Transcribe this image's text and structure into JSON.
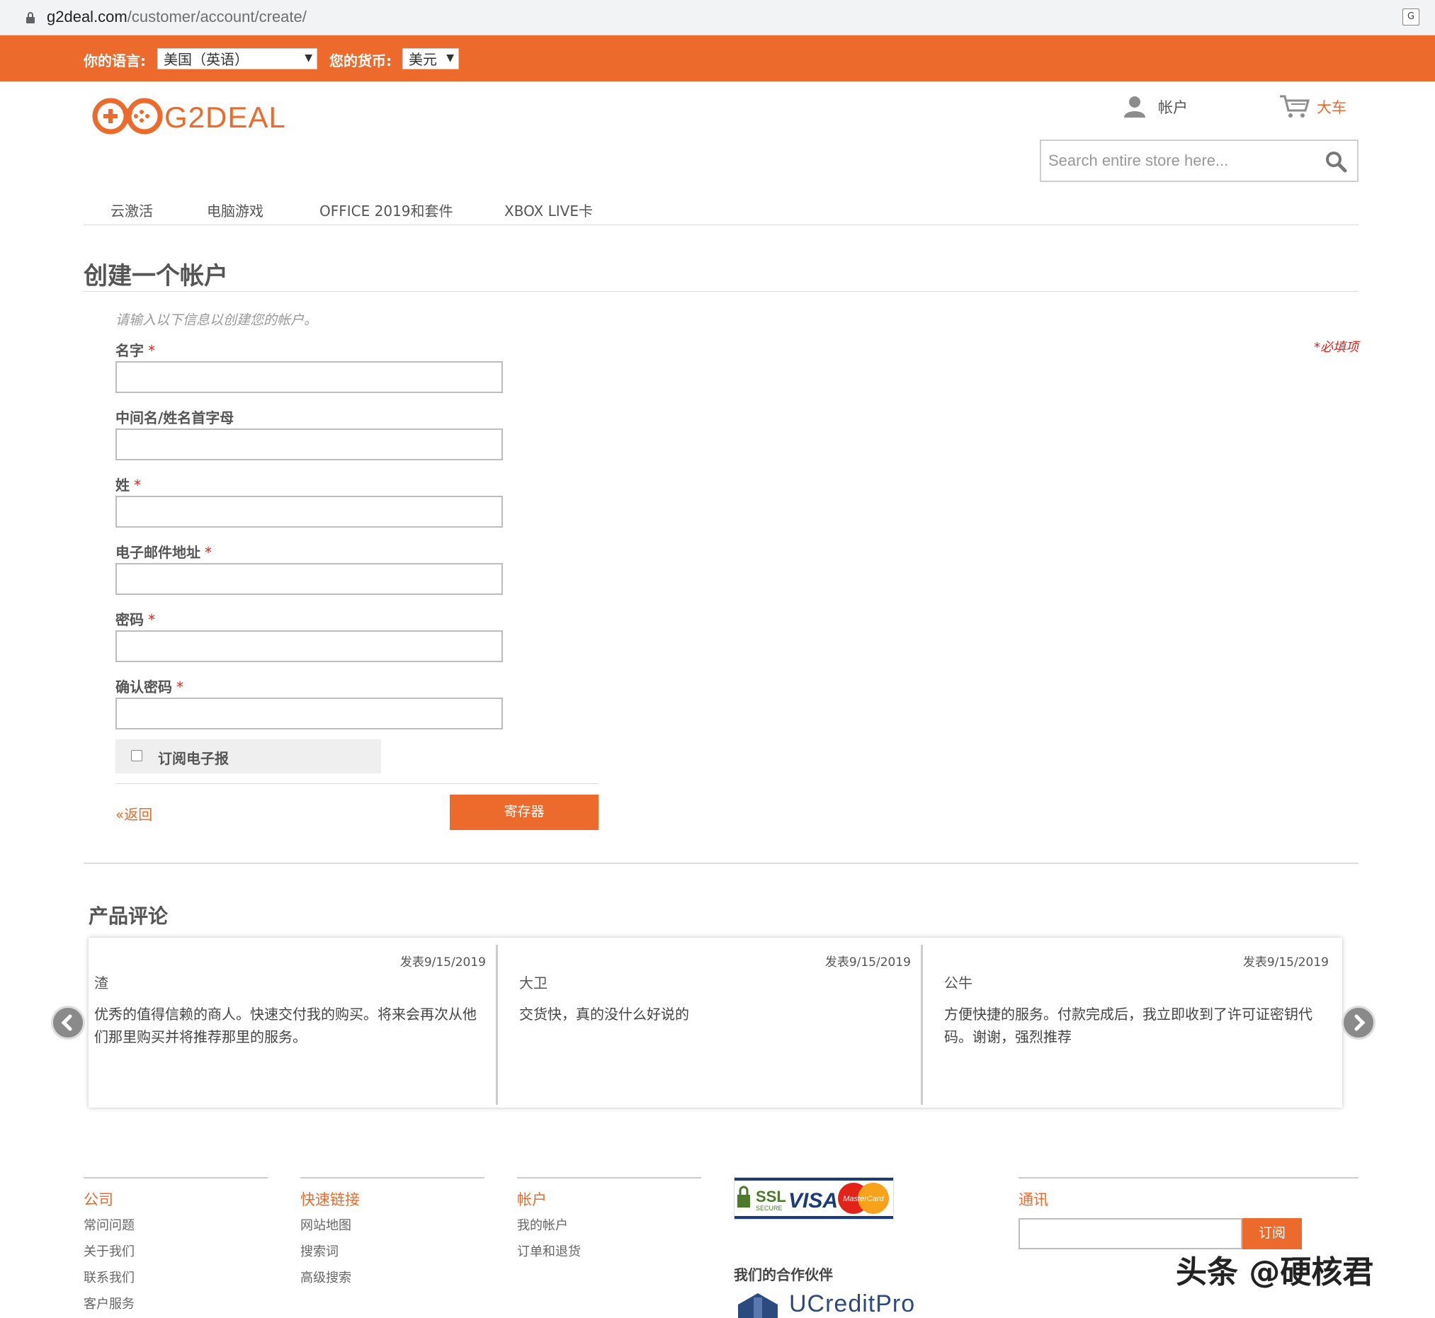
{
  "browser": {
    "url_domain": "g2deal.com",
    "url_path": "/customer/account/create/"
  },
  "topbar": {
    "language_label": "你的语言:",
    "language_value": "美国（英语）",
    "currency_label": "您的货币:",
    "currency_value": "美元"
  },
  "header": {
    "logo_text": "G2DEAL",
    "account_label": "帐户",
    "cart_label": "大车",
    "search_placeholder": "Search entire store here..."
  },
  "nav": {
    "items": [
      "云激活",
      "电脑游戏",
      "OFFICE 2019和套件",
      "XBOX LIVE卡"
    ]
  },
  "form": {
    "title": "创建一个帐户",
    "intro": "请输入以下信息以创建您的帐户。",
    "required_note": "*必填项",
    "required_star": "*",
    "fields": [
      {
        "label": "名字",
        "required": true,
        "value": ""
      },
      {
        "label": "中间名/姓名首字母",
        "required": false,
        "value": ""
      },
      {
        "label": "姓",
        "required": true,
        "value": ""
      },
      {
        "label": "电子邮件地址",
        "required": true,
        "value": ""
      },
      {
        "label": "密码",
        "required": true,
        "value": ""
      },
      {
        "label": "确认密码",
        "required": true,
        "value": ""
      }
    ],
    "newsletter_label": "订阅电子报",
    "newsletter_checked": false,
    "back_label": "«返回",
    "submit_label": "寄存器"
  },
  "reviews": {
    "title": "产品评论",
    "items": [
      {
        "date": "发表9/15/2019",
        "author": "渣",
        "body": "优秀的值得信赖的商人。快速交付我的购买。将来会再次从他们那里购买并将推荐那里的服务。"
      },
      {
        "date": "发表9/15/2019",
        "author": "大卫",
        "body": "交货快，真的没什么好说的"
      },
      {
        "date": "发表9/15/2019",
        "author": "公牛",
        "body": "方便快捷的服务。付款完成后，我立即收到了许可证密钥代码。谢谢，强烈推荐"
      }
    ]
  },
  "footer": {
    "company": {
      "title": "公司",
      "links": [
        "常问问题",
        "关于我们",
        "联系我们",
        "客户服务"
      ]
    },
    "quick_links": {
      "title": "快速链接",
      "links": [
        "网站地图",
        "搜索词",
        "高级搜索"
      ]
    },
    "account": {
      "title": "帐户",
      "links": [
        "我的帐户",
        "订单和退货"
      ]
    },
    "payment_badge": {
      "ssl": "SSL",
      "ssl_sub": "SECURE",
      "visa": "VISA",
      "mastercard": "MasterCard"
    },
    "partners_label": "我们的合作伙伴",
    "partner_name": "UCreditPro",
    "newsletter": {
      "title": "通讯",
      "button": "订阅"
    }
  },
  "watermark": "头条 @硬核君",
  "colors": {
    "brand": "#eb6a2c",
    "required": "#e2231a"
  }
}
